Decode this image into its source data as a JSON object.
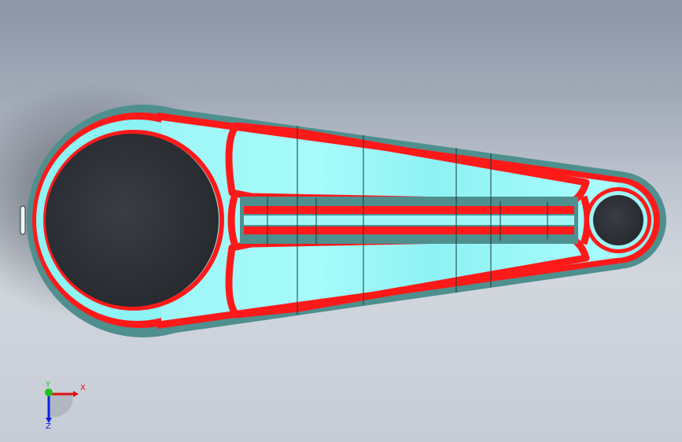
{
  "viewport": {
    "background_top": "#8c96a6",
    "background_bottom": "#d2d7de"
  },
  "part": {
    "face_color": "#99ffff",
    "fillet_color": "#ff0000",
    "edge_side_color": "#4a8c8c",
    "bore_color": "#2f3238"
  },
  "triad": {
    "x_label": "X",
    "y_label": "Y",
    "z_label": "Z",
    "x_color": "#e01010",
    "y_color": "#20c020",
    "z_color": "#1020e0"
  }
}
